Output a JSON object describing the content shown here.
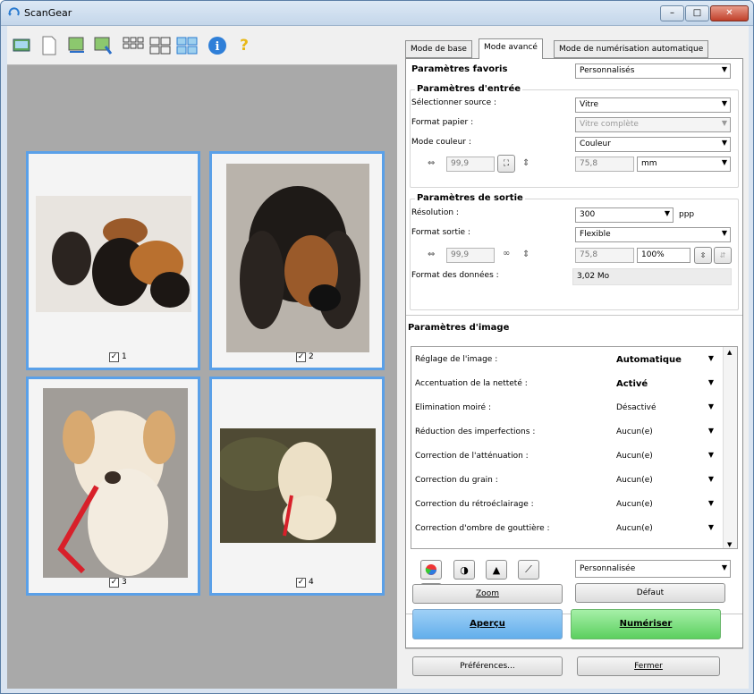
{
  "window": {
    "title": "ScanGear",
    "min": "–",
    "max": "□",
    "close": "✕"
  },
  "toolbar": {
    "icons": [
      "scanner-icon",
      "blank-page-icon",
      "crop-icon",
      "crop-all-icon",
      "thumbnail-view-icon",
      "whole-image-view-icon",
      "select-all-icon",
      "info-icon",
      "help-icon"
    ]
  },
  "thumbs": [
    {
      "num": "1",
      "checked": true
    },
    {
      "num": "2",
      "checked": true
    },
    {
      "num": "3",
      "checked": true
    },
    {
      "num": "4",
      "checked": true
    }
  ],
  "check": "✓",
  "tabs": [
    "Mode de base",
    "Mode avancé",
    "Mode de numérisation automatique"
  ],
  "favorites": {
    "label": "Paramètres favoris",
    "value": "Personnalisés"
  },
  "input": {
    "title": "Paramètres d'entrée",
    "source_label": "Sélectionner source :",
    "source": "Vitre",
    "paper_label": "Format papier :",
    "paper": "Vitre complète",
    "color_label": "Mode couleur :",
    "color": "Couleur",
    "width": "99,9",
    "height": "75,8",
    "unit": "mm"
  },
  "output": {
    "title": "Paramètres de sortie",
    "res_label": "Résolution :",
    "res": "300",
    "res_unit": "ppp",
    "format_label": "Format sortie :",
    "format": "Flexible",
    "width": "99,9",
    "height": "75,8",
    "scale": "100%",
    "size_label": "Format des données :",
    "size": "3,02 Mo"
  },
  "image": {
    "title": "Paramètres d'image",
    "rows": [
      {
        "label": "Réglage de l'image :",
        "value": "Automatique",
        "bold": true
      },
      {
        "label": "Accentuation de la netteté :",
        "value": "Activé",
        "bold": true
      },
      {
        "label": "Elimination moiré :",
        "value": "Désactivé",
        "bold": false
      },
      {
        "label": "Réduction des imperfections :",
        "value": "Aucun(e)",
        "bold": false
      },
      {
        "label": "Correction de l'atténuation :",
        "value": "Aucun(e)",
        "bold": false
      },
      {
        "label": "Correction du grain :",
        "value": "Aucun(e)",
        "bold": false
      },
      {
        "label": "Correction du rétroéclairage :",
        "value": "Aucun(e)",
        "bold": false
      },
      {
        "label": "Correction d'ombre de gouttière :",
        "value": "Aucun(e)",
        "bold": false
      }
    ]
  },
  "tone": {
    "preset": "Personnalisée",
    "default_btn": "Défaut"
  },
  "buttons": {
    "zoom": "Zoom",
    "preview": "Aperçu",
    "scan": "Numériser",
    "prefs": "Préférences...",
    "close": "Fermer"
  },
  "colors": {
    "accent": "#5aa0e8",
    "scan_green": "#66d86a",
    "preview_blue": "#6fb5ee"
  }
}
